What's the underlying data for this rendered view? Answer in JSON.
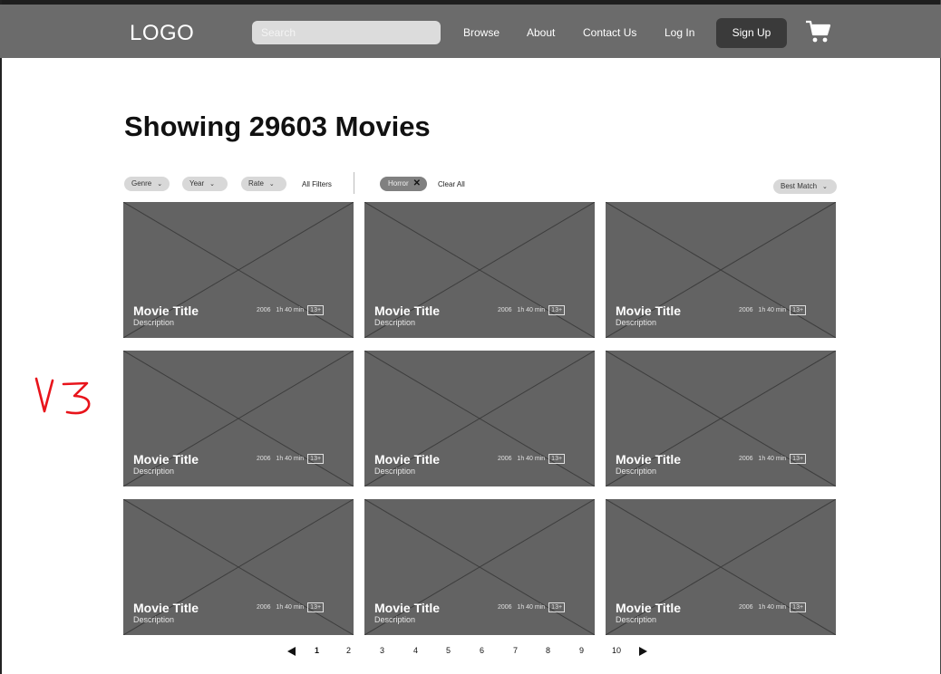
{
  "header": {
    "logo": "LOGO",
    "search_placeholder": "Search",
    "nav": [
      "Browse",
      "About",
      "Contact Us",
      "Log In"
    ],
    "signup_label": "Sign Up",
    "cart_icon": "shopping-cart-icon"
  },
  "annotation": "V3",
  "page": {
    "heading": "Showing 29603 Movies"
  },
  "filters": {
    "chips": [
      "Genre",
      "Year",
      "Rate"
    ],
    "all_filters": "All Filters",
    "active_tag": "Horror",
    "clear_all": "Clear All",
    "sort": "Best Match"
  },
  "movies": [
    {
      "title": "Movie Title",
      "description": "Description",
      "year": "2006",
      "duration": "1h 40 min",
      "rating": "13+"
    },
    {
      "title": "Movie Title",
      "description": "Description",
      "year": "2006",
      "duration": "1h 40 min",
      "rating": "13+"
    },
    {
      "title": "Movie Title",
      "description": "Description",
      "year": "2006",
      "duration": "1h 40 min",
      "rating": "13+"
    },
    {
      "title": "Movie Title",
      "description": "Description",
      "year": "2006",
      "duration": "1h 40 min",
      "rating": "13+"
    },
    {
      "title": "Movie Title",
      "description": "Description",
      "year": "2006",
      "duration": "1h 40 min",
      "rating": "13+"
    },
    {
      "title": "Movie Title",
      "description": "Description",
      "year": "2006",
      "duration": "1h 40 min",
      "rating": "13+"
    },
    {
      "title": "Movie Title",
      "description": "Description",
      "year": "2006",
      "duration": "1h 40 min",
      "rating": "13+"
    },
    {
      "title": "Movie Title",
      "description": "Description",
      "year": "2006",
      "duration": "1h 40 min",
      "rating": "13+"
    },
    {
      "title": "Movie Title",
      "description": "Description",
      "year": "2006",
      "duration": "1h 40 min",
      "rating": "13+"
    }
  ],
  "pagination": {
    "pages": [
      "1",
      "2",
      "3",
      "4",
      "5",
      "6",
      "7",
      "8",
      "9",
      "10"
    ],
    "current": "1"
  },
  "colors": {
    "navbar": "#6b6b6b",
    "card": "#636363",
    "signup": "#3a3a3a",
    "annotation": "#e8141b"
  }
}
